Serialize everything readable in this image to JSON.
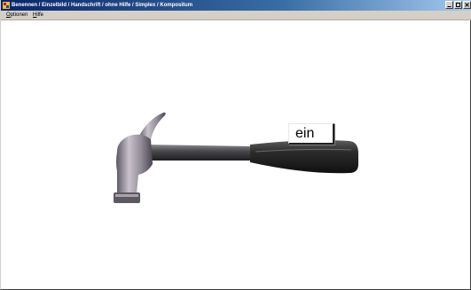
{
  "window": {
    "title": "Benennen / Einzelbild / Handschrift / ohne Hilfe / Simplex / Kompositum",
    "app_icon": "app-icon",
    "controls": [
      "minimize-icon",
      "maximize-icon",
      "close-icon"
    ]
  },
  "menubar": {
    "items": [
      {
        "label_accel": "O",
        "label_rest": "ptionen"
      },
      {
        "label_accel": "H",
        "label_rest": "ilfe"
      }
    ]
  },
  "main": {
    "picture": "hammer",
    "word_button_label": "ein"
  },
  "colors": {
    "titlebar_start": "#0a246a",
    "titlebar_end": "#a6caf0",
    "chrome": "#d4d0c8",
    "canvas": "#ffffff"
  }
}
